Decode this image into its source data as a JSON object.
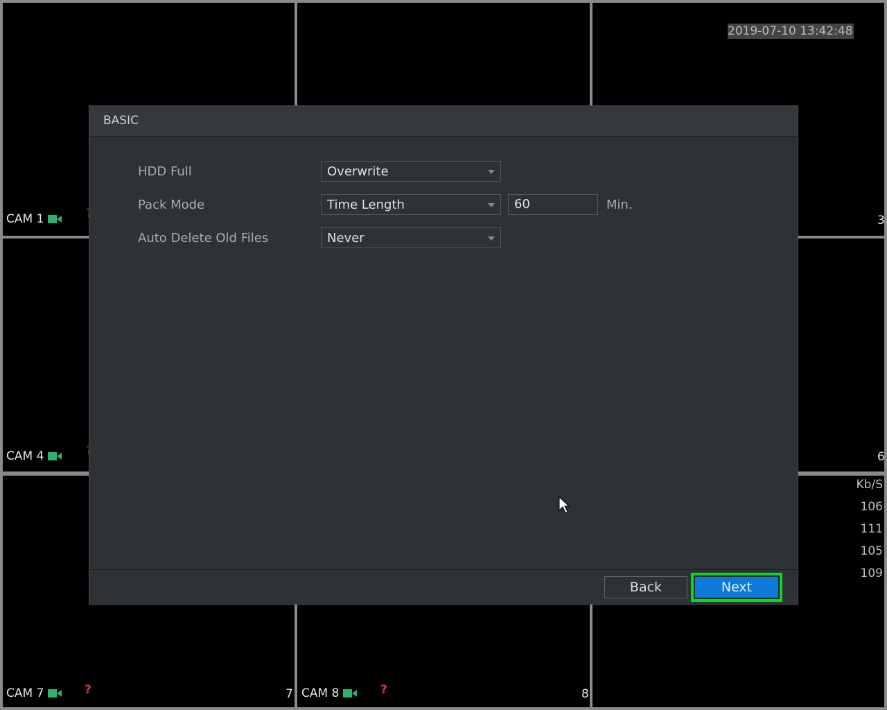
{
  "timestamp": "2019-07-10 13:42:48",
  "cells": [
    {
      "label": "CAM 1",
      "channel": ""
    },
    {
      "label": "",
      "channel": "3"
    },
    {
      "label": "CAM 4",
      "channel": "6"
    },
    {
      "label": "CAM 7",
      "channel": "7"
    },
    {
      "label": "CAM 8",
      "channel": "8"
    }
  ],
  "unknown_icon": "?",
  "bitrate": {
    "unit": "Kb/S",
    "values": [
      "106",
      "111",
      "105",
      "109"
    ]
  },
  "dialog": {
    "title": "BASIC",
    "hdd_full": {
      "label": "HDD Full",
      "value": "Overwrite"
    },
    "pack_mode": {
      "label": "Pack Mode",
      "value": "Time Length",
      "length": "60",
      "unit": "Min."
    },
    "auto_delete": {
      "label": "Auto Delete Old Files",
      "value": "Never"
    },
    "back_label": "Back",
    "next_label": "Next"
  },
  "colors": {
    "accent": "#0d79d9",
    "focus": "#16d12a",
    "camera_icon": "#2fb36b",
    "alert": "#e03a3a"
  }
}
